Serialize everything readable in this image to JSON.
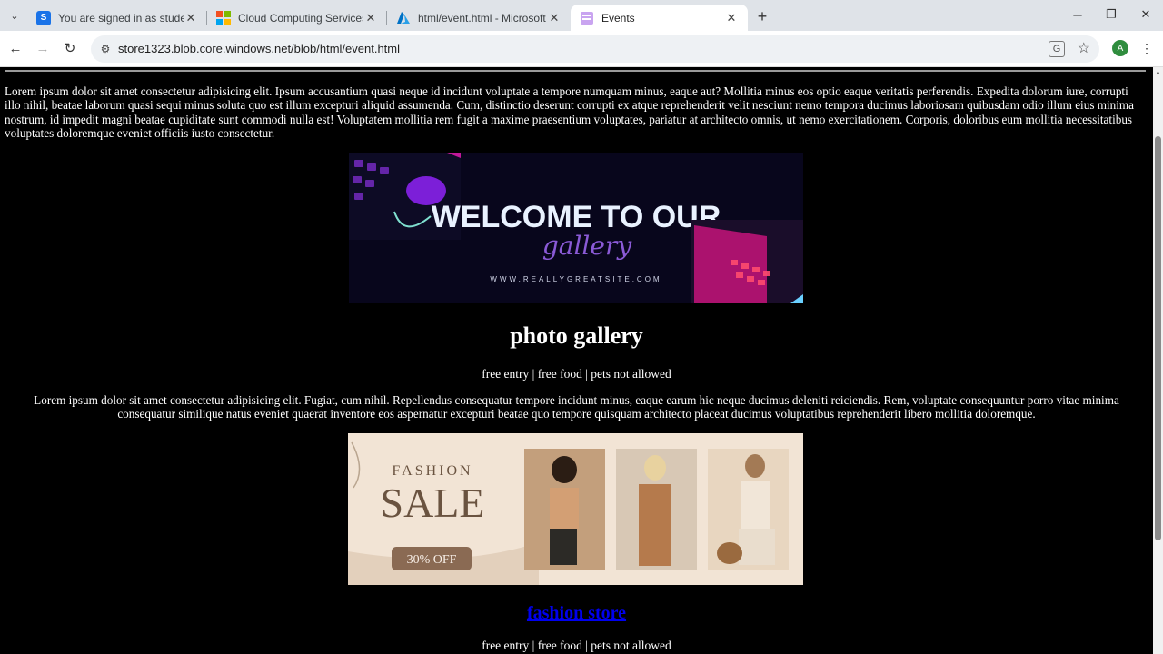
{
  "browser": {
    "tabs": [
      {
        "title": "You are signed in as student",
        "icon": "s-brand-icon",
        "color": "#1a73e8"
      },
      {
        "title": "Cloud Computing Services | Mic",
        "icon": "microsoft-logo-icon"
      },
      {
        "title": "html/event.html - Microsoft Azi",
        "icon": "azure-logo-icon"
      },
      {
        "title": "Events",
        "icon": "page-icon",
        "active": true
      }
    ],
    "url": "store1323.blob.core.windows.net/blob/html/event.html",
    "avatar_letter": "A",
    "avatar_color": "#2f8d3e"
  },
  "page": {
    "intro": "Lorem ipsum dolor sit amet consectetur adipisicing elit. Ipsum accusantium quasi neque id incidunt voluptate a tempore numquam minus, eaque aut? Mollitia minus eos optio eaque veritatis perferendis. Expedita dolorum iure, corrupti illo nihil, beatae laborum quasi sequi minus soluta quo est illum excepturi aliquid assumenda. Cum, distinctio deserunt corrupti ex atque reprehenderit velit nesciunt nemo tempora ducimus laboriosam quibusdam odio illum eius minima nostrum, id impedit magni beatae cupiditate sunt commodi nulla est! Voluptatem mollitia rem fugit a maxime praesentium voluptates, pariatur at architecto omnis, ut nemo exercitationem. Corporis, doloribus eum mollitia necessitatibus voluptates doloremque eveniet officiis iusto consectetur.",
    "gallery_banner": {
      "headline": "WELCOME TO OUR",
      "script": "gallery",
      "site": "WWW.REALLYGREATSITE.COM"
    },
    "gallery_title": "photo gallery",
    "gallery_info": "free entry | free food | pets not allowed",
    "gallery_text": "Lorem ipsum dolor sit amet consectetur adipisicing elit. Fugiat, cum nihil. Repellendus consequatur tempore incidunt minus, eaque earum hic neque ducimus deleniti reiciendis. Rem, voluptate consequuntur porro vitae minima consequatur similique natus eveniet quaerat inventore eos aspernatur excepturi beatae quo tempore quisquam architecto placeat ducimus voluptatibus reprehenderit libero mollitia doloremque.",
    "fashion_banner": {
      "word1": "FASHION",
      "word2": "SALE",
      "badge": "30% OFF"
    },
    "fashion_title": "fashion store",
    "fashion_info": "free entry | free food | pets not allowed"
  }
}
